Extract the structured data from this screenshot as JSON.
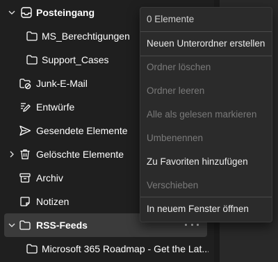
{
  "folders": {
    "posteingang": {
      "label": "Posteingang"
    },
    "ms_berechtigungen": {
      "label": "MS_Berechtigungen"
    },
    "support_cases": {
      "label": "Support_Cases"
    },
    "junk": {
      "label": "Junk-E-Mail"
    },
    "entwuerfe": {
      "label": "Entwürfe"
    },
    "gesendete": {
      "label": "Gesendete Elemente"
    },
    "geloeschte": {
      "label": "Gelöschte Elemente"
    },
    "archiv": {
      "label": "Archiv"
    },
    "notizen": {
      "label": "Notizen"
    },
    "rss_feeds": {
      "label": "RSS-Feeds"
    },
    "roadmap": {
      "label": "Microsoft 365 Roadmap - Get the Lat..."
    }
  },
  "context_menu": {
    "info": "0 Elemente",
    "items": [
      {
        "label": "Neuen Unterordner erstellen",
        "enabled": true
      },
      {
        "label": "Ordner löschen",
        "enabled": false
      },
      {
        "label": "Ordner leeren",
        "enabled": false
      },
      {
        "label": "Alle als gelesen markieren",
        "enabled": false
      },
      {
        "label": "Umbenennen",
        "enabled": false
      },
      {
        "label": "Zu Favoriten hinzufügen",
        "enabled": true
      },
      {
        "label": "Verschieben",
        "enabled": false
      },
      {
        "label": "In neuem Fenster öffnen",
        "enabled": true
      }
    ]
  },
  "icons": {
    "posteingang": "inbox-icon",
    "folder": "folder-icon",
    "junk": "junk-mail-icon",
    "entwuerfe": "draft-pencil-icon",
    "gesendete": "send-icon",
    "geloeschte": "trash-icon",
    "archiv": "archive-icon",
    "notizen": "note-icon",
    "more": "more-options-icon"
  },
  "colors": {
    "background": "#1f1f1f",
    "selected_row": "#3b3b3b",
    "menu_background": "#2b2b2b",
    "text": "#ffffff",
    "disabled_text": "#7a7a7a"
  }
}
